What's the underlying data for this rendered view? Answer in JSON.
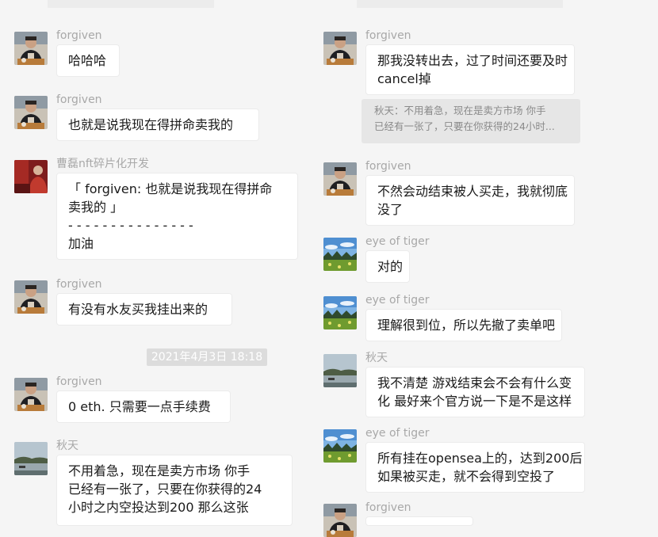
{
  "timestamp": "2021年4月3日 18:18",
  "left_messages": [
    {
      "sender": "forgiven",
      "avatar": "person-avatar",
      "lines": [
        "哈哈哈"
      ]
    },
    {
      "sender": "forgiven",
      "avatar": "person-avatar",
      "lines": [
        "也就是说我现在得拼命卖我的"
      ]
    },
    {
      "sender": "曹磊nft碎片化开发",
      "avatar": "red-avatar",
      "lines": [
        "「 forgiven: 也就是说我现在得拼命",
        "卖我的 」",
        "- - - - - - - - - - - - - - -",
        "加油"
      ]
    },
    {
      "sender": "forgiven",
      "avatar": "person-avatar",
      "lines": [
        "有没有水友买我挂出来的"
      ]
    },
    {
      "sender": "forgiven",
      "avatar": "person-avatar",
      "lines": [
        "0 eth. 只需要一点手续费"
      ]
    },
    {
      "sender": "秋天",
      "avatar": "lake-avatar",
      "lines": [
        "不用着急，现在是卖方市场      你手",
        "已经有一张了，只要在你获得的24",
        "小时之内空投达到200    那么这张"
      ]
    }
  ],
  "right_messages": [
    {
      "sender": "forgiven",
      "avatar": "person-avatar",
      "lines": [
        "那我没转出去，过了时间还要及时",
        "cancel掉"
      ]
    },
    {
      "sender": "forgiven",
      "avatar": "person-avatar",
      "lines": [
        "不然会动结束被人买走，我就彻底",
        "没了"
      ]
    },
    {
      "sender": "eye of tiger",
      "avatar": "landscape-avatar",
      "lines": [
        "对的"
      ]
    },
    {
      "sender": "eye of tiger",
      "avatar": "landscape-avatar",
      "lines": [
        "理解很到位，所以先撤了卖单吧"
      ]
    },
    {
      "sender": "秋天",
      "avatar": "lake-avatar",
      "lines": [
        "我不清楚  游戏结束会不会有什么变",
        "化   最好来个官方说一下是不是这样"
      ]
    },
    {
      "sender": "eye of tiger",
      "avatar": "landscape-avatar",
      "lines": [
        "所有挂在opensea上的，达到200后",
        "如果被买走，就不会得到空投了"
      ]
    },
    {
      "sender": "forgiven",
      "avatar": "person-avatar",
      "lines": []
    }
  ],
  "right_quote": {
    "lines": [
      "秋天：不用着急，现在是卖方市场      你手",
      "已经有一张了，只要在你获得的24小时..."
    ]
  }
}
